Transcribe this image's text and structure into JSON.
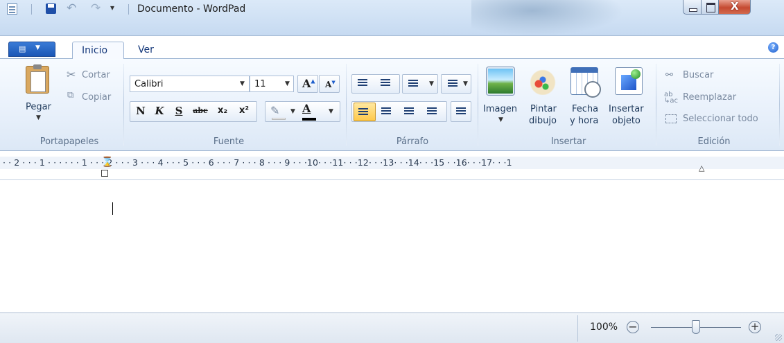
{
  "window": {
    "title": "Documento - WordPad",
    "controls": {
      "minimize": "minimize",
      "maximize": "maximize",
      "close": "close"
    }
  },
  "tabs": [
    {
      "label": "Inicio",
      "active": true
    },
    {
      "label": "Ver",
      "active": false
    }
  ],
  "groups": {
    "clipboard": {
      "label": "Portapapeles",
      "paste": "Pegar",
      "cut": "Cortar",
      "copy": "Copiar"
    },
    "font": {
      "label": "Fuente",
      "family": "Calibri",
      "size": "11",
      "bold": "N",
      "italic": "K",
      "underline": "S",
      "strike": "abc",
      "subscript": "x₂",
      "superscript": "x²"
    },
    "paragraph": {
      "label": "Párrafo"
    },
    "insert": {
      "label": "Insertar",
      "image": "Imagen",
      "paint_line1": "Pintar",
      "paint_line2": "dibujo",
      "datetime_line1": "Fecha",
      "datetime_line2": "y hora",
      "object_line1": "Insertar",
      "object_line2": "objeto"
    },
    "editing": {
      "label": "Edición",
      "find": "Buscar",
      "replace": "Reemplazar",
      "select_all": "Seleccionar todo"
    }
  },
  "ruler": {
    "text": "· · 2 · · · 1 · · ·   · · · 1 · · · 2 · · · 3 · · · 4 · · · 5 · · · 6 · · · 7 · · · 8 · · · 9 · · ·10· · ·11· · ·12· · ·13· · ·14· · ·15  · ·16· · ·17· · ·1"
  },
  "status": {
    "zoom": "100%",
    "zoom_fraction": 0.5
  },
  "colors": {
    "ribbon": "#dfeaf7",
    "accent": "#1a56b6",
    "highlight": "#ffd76a"
  }
}
